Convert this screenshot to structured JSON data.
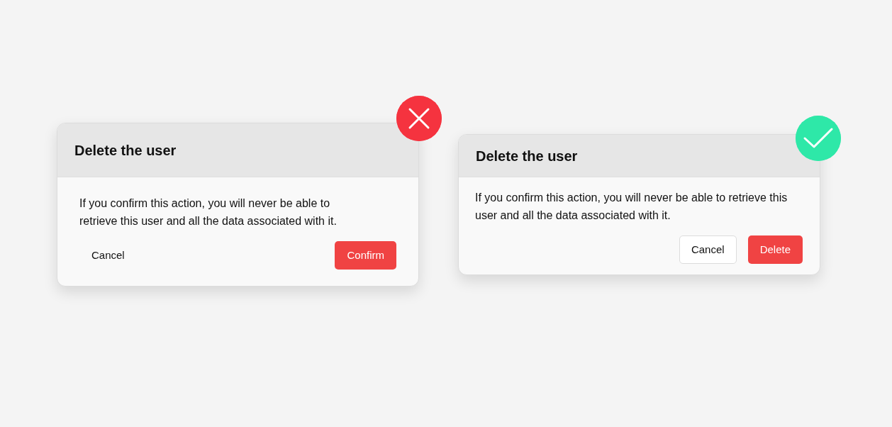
{
  "dialogs": [
    {
      "kind": "bad",
      "title": "Delete the user",
      "message": "If you confirm this action, you will never be able to retrieve this user and all the data associated with it.",
      "buttons": [
        {
          "label": "Cancel",
          "kind": "text"
        },
        {
          "label": "Confirm",
          "kind": "danger"
        }
      ]
    },
    {
      "kind": "good",
      "title": "Delete the user",
      "message": "If you confirm this action, you will never be able to retrieve this user and all the data associated with it.",
      "buttons": [
        {
          "label": "Cancel",
          "kind": "outline"
        },
        {
          "label": "Delete",
          "kind": "danger"
        }
      ]
    }
  ]
}
